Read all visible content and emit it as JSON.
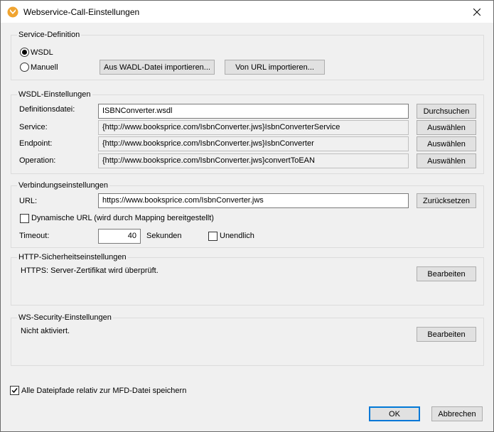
{
  "window": {
    "title": "Webservice-Call-Einstellungen"
  },
  "service_definition": {
    "legend": "Service-Definition",
    "options": [
      {
        "label": "WSDL",
        "selected": true
      },
      {
        "label": "Manuell",
        "selected": false
      }
    ],
    "import_wadl_label": "Aus WADL-Datei importieren...",
    "import_url_label": "Von URL importieren..."
  },
  "wsdl_settings": {
    "legend": "WSDL-Einstellungen",
    "definition_file": {
      "label": "Definitionsdatei:",
      "value": "ISBNConverter.wsdl",
      "button": "Durchsuchen"
    },
    "service": {
      "label": "Service:",
      "value": "{http://www.booksprice.com/IsbnConverter.jws}IsbnConverterService",
      "button": "Auswählen"
    },
    "endpoint": {
      "label": "Endpoint:",
      "value": "{http://www.booksprice.com/IsbnConverter.jws}IsbnConverter",
      "button": "Auswählen"
    },
    "operation": {
      "label": "Operation:",
      "value": "{http://www.booksprice.com/IsbnConverter.jws}convertToEAN",
      "button": "Auswählen"
    }
  },
  "connection": {
    "legend": "Verbindungseinstellungen",
    "url_label": "URL:",
    "url_value": "https://www.booksprice.com/IsbnConverter.jws",
    "reset_label": "Zurücksetzen",
    "dynamic_url": {
      "label": "Dynamische URL (wird durch Mapping bereitgestellt)",
      "checked": false
    },
    "timeout_label": "Timeout:",
    "timeout_value": "40",
    "timeout_unit": "Sekunden",
    "infinite": {
      "label": "Unendlich",
      "checked": false
    }
  },
  "http_security": {
    "legend": "HTTP-Sicherheitseinstellungen",
    "status": "HTTPS: Server-Zertifikat wird überprüft.",
    "edit_label": "Bearbeiten"
  },
  "ws_security": {
    "legend": "WS-Security-Einstellungen",
    "status": "Nicht aktiviert.",
    "edit_label": "Bearbeiten"
  },
  "footer": {
    "relative_paths": {
      "label": "Alle Dateipfade relativ zur MFD-Datei speichern",
      "checked": true
    },
    "ok_label": "OK",
    "cancel_label": "Abbrechen"
  },
  "colors": {
    "accent": "#0078d7",
    "icon_orange": "#f0a430"
  },
  "icons": [
    "app-icon",
    "close-icon",
    "checkmark-icon"
  ]
}
